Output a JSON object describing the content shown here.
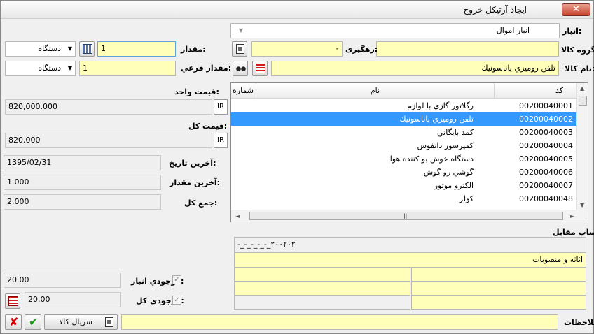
{
  "window": {
    "title": "ایجاد آرتیکل خروج",
    "close": "✕"
  },
  "form": {
    "warehouse_label": "انبار:",
    "warehouse_value": "انبار اموال",
    "group_label": "گروه کالا:",
    "group_value": "",
    "tracking_label": "رهگیری:",
    "tracking_value": "۰",
    "item_name_label": "نام کالا:",
    "item_name_value": "تلفن روميزي پاناسونيك",
    "quantity_label": "مقدار:",
    "quantity_value": "1",
    "quantity_unit": "دستگاه",
    "subquantity_label": "مقدار فرعي:",
    "subquantity_value": "1",
    "subquantity_unit": "دستگاه",
    "unit_price_label": "قيمت واحد:",
    "unit_price_value": "820,000.000",
    "unit_price_currency": "IR",
    "total_price_label": "قيمت كل:",
    "total_price_value": "820,000",
    "total_price_currency": "IR",
    "last_date_label": "آخرين تاريخ:",
    "last_date_value": "1395/02/31",
    "last_qty_label": "آخرين مقدار:",
    "last_qty_value": "1.000",
    "total_sum_label": "جمع كل:",
    "total_sum_value": "2.000",
    "stock_wh_label": "موجودي انبار:",
    "stock_wh_value": "20.00",
    "stock_total_label": "موجودي كل:",
    "stock_total_value": "20.00",
    "account_label": "حساب مقابل",
    "account_code": "-_-_-_-_-_۲۰۰۲۰۲",
    "account_name": "اثاثه و منصوبات",
    "notes_label": "ملاحظات:",
    "notes_value": "",
    "serial_button": "سريال كالا"
  },
  "grid": {
    "headers": {
      "code": "کد",
      "name": "نام",
      "number": "شماره"
    },
    "rows": [
      {
        "code": "00200040001",
        "name": "رگلاتور گازي با لوازم",
        "selected": false
      },
      {
        "code": "00200040002",
        "name": "تلفن روميزي پاناسونيك",
        "selected": true
      },
      {
        "code": "00200040003",
        "name": "كمد بايگاني",
        "selected": false
      },
      {
        "code": "00200040004",
        "name": "كمپرسور دانفوس",
        "selected": false
      },
      {
        "code": "00200040005",
        "name": "دستگاه خوش بو كننده هوا",
        "selected": false
      },
      {
        "code": "00200040006",
        "name": "گوشي رو گوش",
        "selected": false
      },
      {
        "code": "00200040007",
        "name": "الكترو موتور",
        "selected": false
      },
      {
        "code": "00200040048",
        "name": "كولر",
        "selected": false
      }
    ]
  },
  "colors": {
    "yellow_field": "#ffffb9",
    "selection": "#3399ff",
    "close_red": "#c7412c"
  }
}
